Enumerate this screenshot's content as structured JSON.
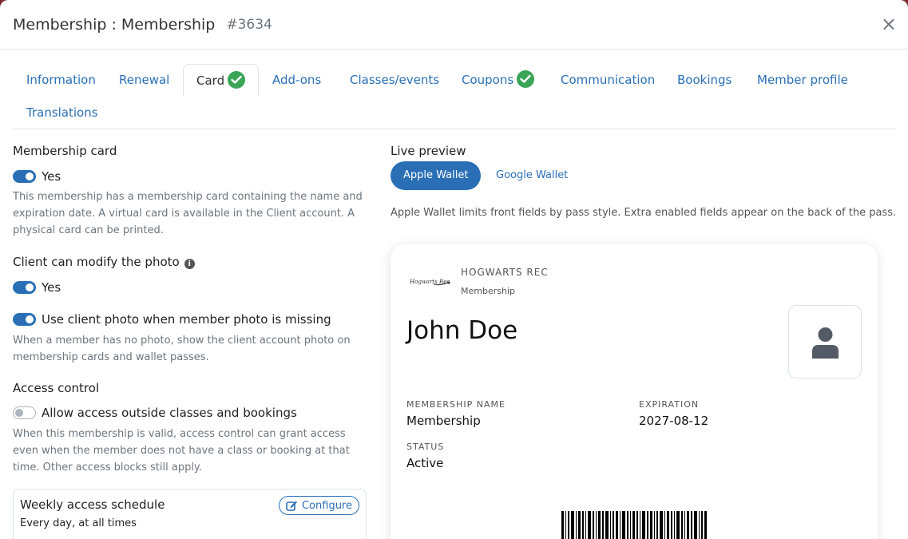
{
  "header": {
    "title": "Membership : Membership",
    "id": "#3634",
    "close": "×"
  },
  "tabs": [
    {
      "label": "Information"
    },
    {
      "label": "Renewal"
    },
    {
      "label": "Card",
      "checked": true,
      "active": true
    },
    {
      "label": "Add-ons"
    },
    {
      "label": "Classes/events"
    },
    {
      "label": "Coupons",
      "checked": true
    },
    {
      "label": "Communication"
    },
    {
      "label": "Bookings"
    },
    {
      "label": "Member profile"
    },
    {
      "label": "Translations"
    }
  ],
  "left": {
    "membership_card": {
      "label": "Membership card",
      "toggle_label": "Yes",
      "enabled": true,
      "help": "This membership has a membership card containing the name and expiration date. A virtual card is available in the Client account. A physical card can be printed."
    },
    "modify_photo": {
      "label": "Client can modify the photo",
      "toggle_label": "Yes",
      "enabled": true
    },
    "use_client_photo": {
      "toggle_label": "Use client photo when member photo is missing",
      "enabled": true,
      "help": "When a member has no photo, show the client account photo on membership cards and wallet passes."
    },
    "access_control": {
      "label": "Access control",
      "toggle_label": "Allow access outside classes and bookings",
      "enabled": false,
      "help": "When this membership is valid, access control can grant access even when the member does not have a class or booking at that time. Other access blocks still apply."
    },
    "schedule": {
      "title": "Weekly access schedule",
      "value": "Every day, at all times",
      "configure_label": "Configure"
    }
  },
  "right": {
    "label": "Live preview",
    "apple_wallet": "Apple Wallet",
    "google_wallet": "Google Wallet",
    "note": "Apple Wallet limits front fields by pass style. Extra enabled fields appear on the back of the pass.",
    "pass": {
      "logo_text": "Hogwarts Rec",
      "org": "HOGWARTS REC",
      "type": "Membership",
      "name": "John Doe",
      "membership_name_label": "MEMBERSHIP NAME",
      "membership_name": "Membership",
      "expiration_label": "EXPIRATION",
      "expiration": "2027-08-12",
      "status_label": "STATUS",
      "status": "Active"
    }
  },
  "colors": {
    "accent": "#2a6fb5",
    "success": "#3aa557",
    "muted": "#6c757d"
  }
}
